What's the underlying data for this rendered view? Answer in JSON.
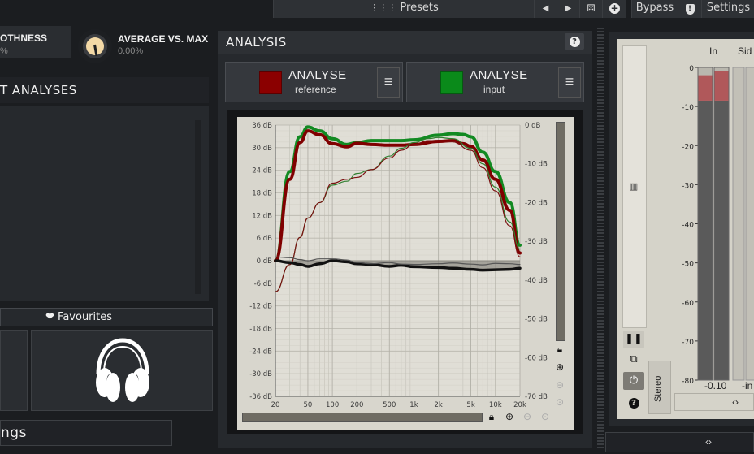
{
  "topbar": {
    "presets_label": "Presets",
    "bypass_label": "Bypass",
    "settings_label": "Settings"
  },
  "left": {
    "smoothness_label": "OTHNESS",
    "smoothness_value": "%",
    "avg_label": "AVERAGE VS. MAX",
    "avg_value": "0.00%",
    "analyses_header": "T ANALYSES",
    "favourites_label": "Favourites",
    "settings_label": "ngs"
  },
  "analysis": {
    "title": "ANALYSIS",
    "ref_button_title": "ANALYSE",
    "ref_button_sub": "reference",
    "ref_color": "#8b0000",
    "input_button_title": "ANALYSE",
    "input_button_sub": "input",
    "input_color": "#0a8a1a"
  },
  "chart_data": {
    "type": "line",
    "x_ticks": [
      "20",
      "50",
      "100",
      "200",
      "500",
      "1k",
      "2k",
      "5k",
      "10k",
      "20k"
    ],
    "x_values": [
      20,
      50,
      100,
      200,
      500,
      1000,
      2000,
      5000,
      10000,
      20000
    ],
    "left_ticks": [
      "36 dB",
      "30 dB",
      "24 dB",
      "18 dB",
      "12 dB",
      "6 dB",
      "0 dB",
      "-6 dB",
      "-12 dB",
      "-18 dB",
      "-24 dB",
      "-30 dB",
      "-36 dB"
    ],
    "left_values": [
      36,
      30,
      24,
      18,
      12,
      6,
      0,
      -6,
      -12,
      -18,
      -24,
      -30,
      -36
    ],
    "right_ticks": [
      "0 dB",
      "-10 dB",
      "-20 dB",
      "-30 dB",
      "-40 dB",
      "-50 dB",
      "-60 dB",
      "-70 dB"
    ],
    "right_values": [
      0,
      -10,
      -20,
      -30,
      -40,
      -50,
      -60,
      -70
    ],
    "left_ylim": [
      -36,
      36
    ],
    "right_ylim": [
      -70,
      0
    ],
    "xlim": [
      20,
      20000
    ],
    "x_scale": "log",
    "grid": true,
    "series": [
      {
        "color": "#128a22",
        "width": 4,
        "axis": "right",
        "x": [
          20,
          30,
          40,
          50,
          70,
          100,
          150,
          200,
          300,
          500,
          700,
          1000,
          2000,
          3000,
          4000,
          5000,
          7000,
          10000,
          15000,
          20000
        ],
        "y": [
          -35,
          -12,
          -3,
          -0.5,
          -1.5,
          -3.5,
          -5,
          -4.5,
          -4,
          -4,
          -4,
          -3.8,
          -2.6,
          -2.2,
          -2.4,
          -3,
          -7,
          -12,
          -20,
          -31
        ]
      },
      {
        "color": "#800000",
        "width": 4,
        "axis": "right",
        "x": [
          20,
          30,
          40,
          50,
          70,
          100,
          150,
          200,
          300,
          500,
          700,
          1000,
          2000,
          3000,
          4000,
          5000,
          7000,
          10000,
          15000,
          20000
        ],
        "y": [
          -35,
          -14,
          -4.5,
          -1.5,
          -2.5,
          -4.8,
          -5.6,
          -4.7,
          -5,
          -5.2,
          -5.2,
          -5,
          -4.2,
          -4,
          -4.8,
          -5.5,
          -9,
          -14,
          -22,
          -33
        ]
      },
      {
        "color": "#2f7f2f",
        "width": 1.2,
        "axis": "right",
        "x": [
          20,
          30,
          40,
          50,
          70,
          100,
          150,
          200,
          300,
          500,
          700,
          1000,
          1500,
          2000,
          3000,
          5000,
          7000,
          10000,
          15000,
          20000
        ],
        "y": [
          -43,
          -36,
          -29,
          -24,
          -20,
          -15.5,
          -14.5,
          -12.5,
          -11.5,
          -8,
          -6,
          -4.5,
          -3.5,
          -3.2,
          -3.5,
          -6,
          -10,
          -16,
          -25,
          -32
        ]
      },
      {
        "color": "#7a1010",
        "width": 1.2,
        "axis": "right",
        "x": [
          20,
          30,
          40,
          50,
          70,
          100,
          150,
          200,
          300,
          500,
          700,
          1000,
          1500,
          2000,
          3000,
          5000,
          7000,
          10000,
          15000,
          20000
        ],
        "y": [
          -43,
          -36,
          -29,
          -24,
          -20,
          -15,
          -14,
          -13.5,
          -11.5,
          -8.5,
          -6.5,
          -5,
          -4,
          -4,
          -4.3,
          -6.5,
          -11,
          -17,
          -26,
          -34
        ]
      },
      {
        "color": "#111111",
        "width": 3.5,
        "axis": "left",
        "x": [
          20,
          30,
          40,
          50,
          70,
          100,
          150,
          200,
          300,
          500,
          700,
          1000,
          2000,
          3000,
          5000,
          7000,
          10000,
          15000,
          20000
        ],
        "y": [
          0,
          -0.5,
          -1,
          -1.5,
          -0.8,
          0,
          -0.3,
          -0.8,
          -1,
          -1.5,
          -1.2,
          -1.6,
          -1.8,
          -2,
          -2.3,
          -2.5,
          -2.4,
          -2.3,
          -2
        ]
      },
      {
        "color": "#555555",
        "width": 1.2,
        "axis": "left",
        "x": [
          20,
          30,
          40,
          50,
          70,
          100,
          150,
          200,
          300,
          500,
          700,
          1000,
          2000,
          3000,
          5000,
          7000,
          10000,
          15000,
          20000
        ],
        "y": [
          1,
          0.8,
          0.3,
          0,
          0.5,
          0.5,
          0.2,
          -0.5,
          -0.8,
          -0.5,
          -0.9,
          -1,
          -0.8,
          -0.6,
          -0.9,
          -1.1,
          -0.7,
          -0.8,
          -1
        ]
      }
    ]
  },
  "meter": {
    "in_label": "In",
    "side_label": "Sid",
    "ticks": [
      "0",
      "-10",
      "-20",
      "-30",
      "-40",
      "-50",
      "-60",
      "-70",
      "-80"
    ],
    "tick_values": [
      0,
      -10,
      -20,
      -30,
      -40,
      -50,
      -60,
      -70,
      -80
    ],
    "in_peak_value": "-0.10",
    "side_value": "-in",
    "stereo_label": "Stereo",
    "in_left_level": -8.5,
    "in_right_level": -8.5,
    "in_left_peak": -2,
    "in_right_peak": -1,
    "expand_label": "‹›",
    "bottom_expand_label": "‹›"
  }
}
